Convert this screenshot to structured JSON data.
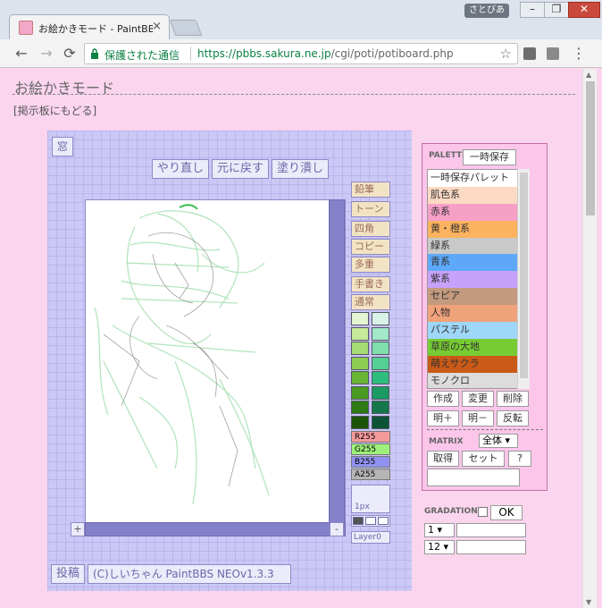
{
  "browser": {
    "tab_title": "お絵かきモード - PaintBBS",
    "tab_close": "×",
    "user_badge": "さとびあ",
    "window_min": "–",
    "window_max": "❐",
    "window_close": "✕",
    "secure_label": "保護された通信",
    "url_host": "https://pbbs.sakura.ne.jp",
    "url_path": "/cgi/poti/potiboard.php",
    "back": "←",
    "forward": "→",
    "reload": "⟳",
    "star": "☆",
    "menu": "⋮"
  },
  "page": {
    "heading": "お絵かきモード",
    "back_link": "[掲示板にもどる]"
  },
  "paintbbs": {
    "window_btn": "窓",
    "redo": "やり直し",
    "undo": "元に戻す",
    "fill": "塗り潰し",
    "tools": [
      "鉛筆",
      "トーン",
      "四角",
      "コピー",
      "多重",
      "手書き",
      "通常"
    ],
    "swatches_left": [
      "#e4f5d4",
      "#c6ea9a",
      "#a6dc74",
      "#8dcd54",
      "#6ab536",
      "#4a9a22",
      "#2f7a14",
      "#1d5508"
    ],
    "swatches_right": [
      "#d8f2e8",
      "#a3e8c8",
      "#7fdfad",
      "#55d094",
      "#2fbd7e",
      "#1c9a63",
      "#15784c",
      "#0d5436"
    ],
    "rgba": {
      "r": "R255",
      "g": "G255",
      "b": "B255",
      "a": "A255"
    },
    "rgba_colors": {
      "r": "#f49a9a",
      "g": "#9df07a",
      "b": "#9292f2",
      "a": "#b5b5b5"
    },
    "pen_size": "1px",
    "layer": "Layer0",
    "plus": "+",
    "minus": "-",
    "post": "投稿",
    "credit": "(C)しいちゃん PaintBBS NEOv1.3.3"
  },
  "palette": {
    "label": "PALETTE",
    "temp_save": "一時保存",
    "items": [
      {
        "label": "一時保存パレット",
        "color": "#ffffff"
      },
      {
        "label": "肌色系",
        "color": "#fcd9c3"
      },
      {
        "label": "赤系",
        "color": "#f6a0c6"
      },
      {
        "label": "黄・橙系",
        "color": "#fcb25e"
      },
      {
        "label": "緑系",
        "color": "#c9c9c9"
      },
      {
        "label": "青系",
        "color": "#5ea8fa"
      },
      {
        "label": "紫系",
        "color": "#c7a2fa"
      },
      {
        "label": "セピア",
        "color": "#c39a7e"
      },
      {
        "label": "人物",
        "color": "#f0a27a"
      },
      {
        "label": "パステル",
        "color": "#9fd7f9"
      },
      {
        "label": "草原の大地",
        "color": "#77cc33"
      },
      {
        "label": "萌えサクラ",
        "color": "#c95a17"
      },
      {
        "label": "モノクロ",
        "color": "#dcdcdc"
      }
    ],
    "create": "作成",
    "change": "変更",
    "delete": "削除",
    "bright_plus": "明＋",
    "bright_minus": "明－",
    "invert": "反転",
    "matrix_label": "MATRIX",
    "matrix_select": "全体",
    "get": "取得",
    "set": "セット",
    "help": "?"
  },
  "gradation": {
    "label": "GRADATION",
    "ok": "OK",
    "sel1": "1",
    "sel2": "12"
  }
}
